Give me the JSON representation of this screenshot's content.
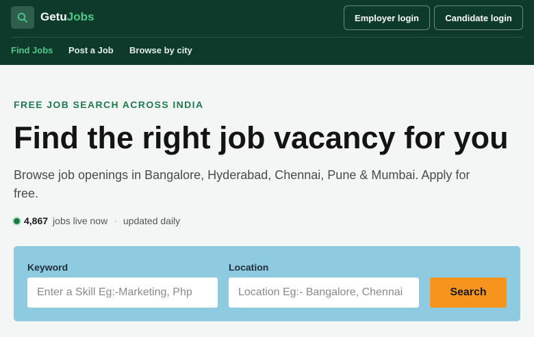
{
  "header": {
    "brand_part1": "Getu",
    "brand_part2": "Jobs",
    "employer_login": "Employer login",
    "candidate_login": "Candidate login",
    "nav": [
      "Find Jobs",
      "Post a Job",
      "Browse by city"
    ]
  },
  "hero": {
    "eyebrow": "FREE JOB SEARCH ACROSS INDIA",
    "headline": "Find the right job vacancy for you",
    "subtext": "Browse job openings in Bangalore, Hyderabad, Chennai, Pune & Mumbai. Apply for free.",
    "stats": {
      "count": "4,867",
      "live_text": "jobs live now",
      "separator": "·",
      "updated_text": "updated daily"
    }
  },
  "search": {
    "keyword_label": "Keyword",
    "keyword_placeholder": "Enter a Skill Eg:-Marketing, Php",
    "location_label": "Location",
    "location_placeholder": "Location Eg:- Bangalore, Chennai",
    "button_label": "Search"
  },
  "colors": {
    "header_bg": "#0e3a2b",
    "brand_accent": "#4cc98b",
    "panel_bg": "#8ecae0",
    "search_button": "#f7941d"
  },
  "icons": {
    "logo": "search-icon",
    "status": "live-dot-icon"
  }
}
